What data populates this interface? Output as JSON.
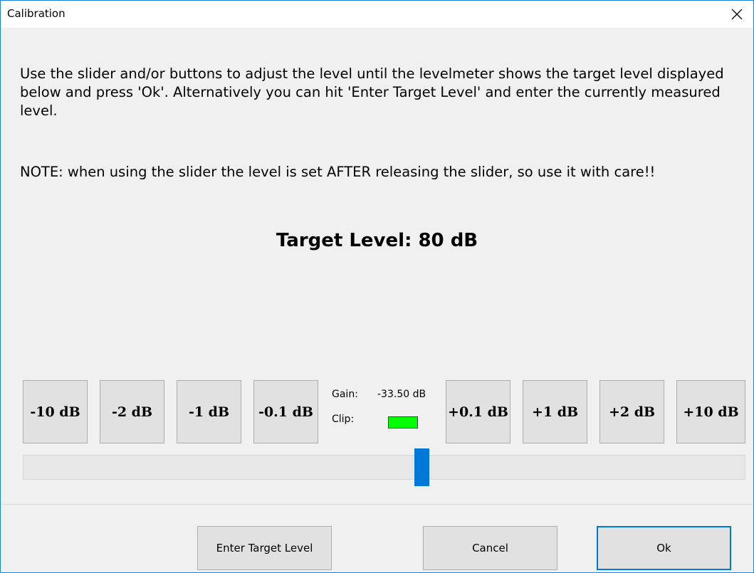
{
  "window": {
    "title": "Calibration"
  },
  "message": {
    "instructions": "Use the slider and/or buttons to adjust the level until the levelmeter shows the target level displayed below and press 'Ok'. Alternatively you can hit 'Enter Target Level' and enter the currently measured level.",
    "note": "NOTE: when using the slider the level is set AFTER releasing the slider, so use it with care!!"
  },
  "target_level": "Target Level: 80 dB",
  "buttons": {
    "minus10": "-10 dB",
    "minus2": "-2 dB",
    "minus1": "-1 dB",
    "minus01": "-0.1 dB",
    "plus01": "+0.1 dB",
    "plus1": "+1 dB",
    "plus2": "+2 dB",
    "plus10": "+10 dB"
  },
  "gain": {
    "label": "Gain:",
    "value": "-33.50 dB"
  },
  "clip": {
    "label": "Clip:",
    "color": "#00ff00"
  },
  "slider": {
    "position_fraction": 0.55
  },
  "footer": {
    "enter_target": "Enter Target Level",
    "cancel": "Cancel",
    "ok": "Ok"
  },
  "icons": {
    "close": "close-icon"
  }
}
